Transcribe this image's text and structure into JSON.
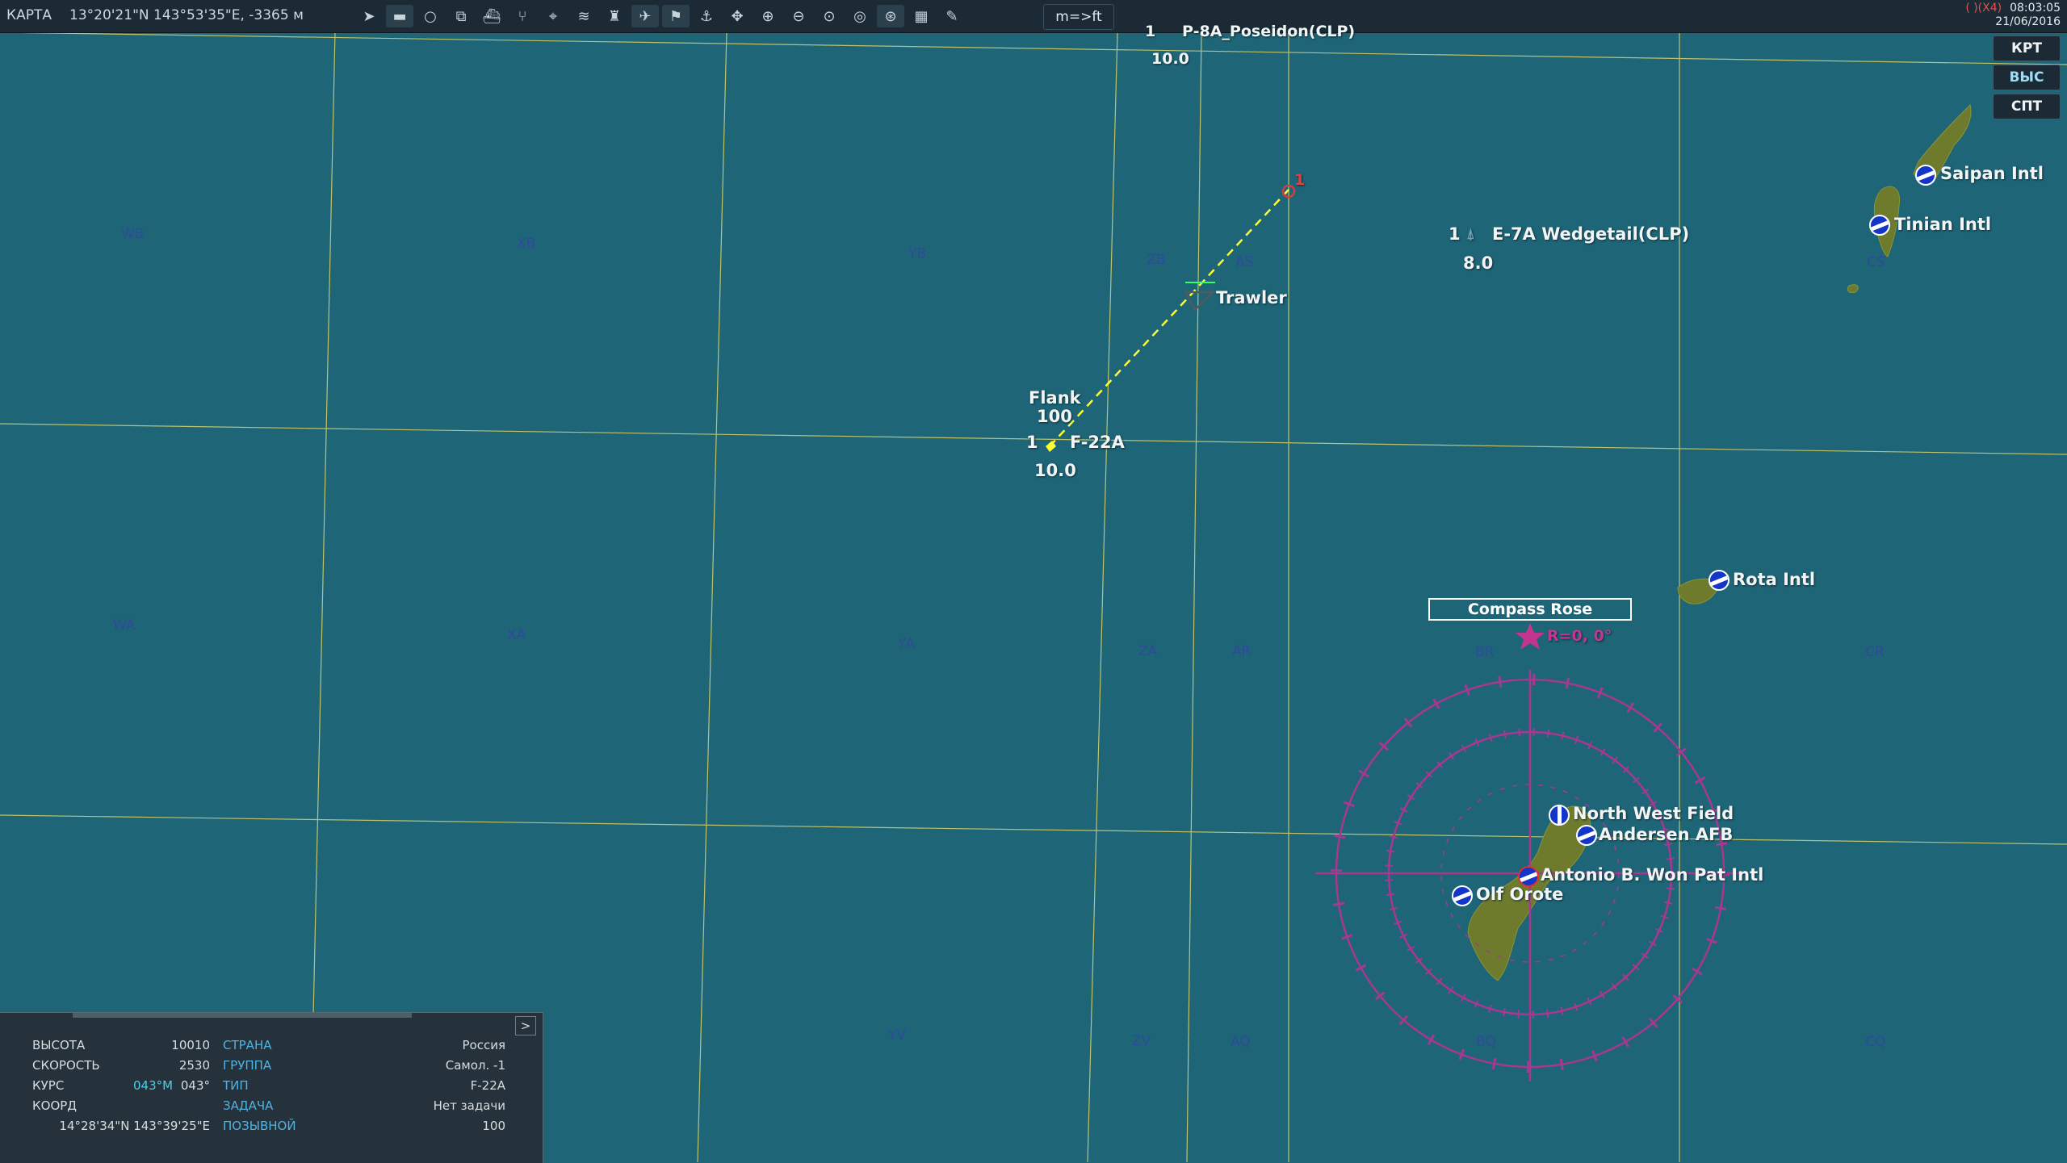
{
  "header": {
    "mode": "КАРТА",
    "cursor_coords": "13°20'21\"N 143°53'35\"E, -3365 м",
    "units_button": "m=>ft",
    "warning": "( )(X4)",
    "time": "08:03:05",
    "date": "21/06/2016"
  },
  "right_buttons": [
    "КРТ",
    "ВЫС",
    "СПТ"
  ],
  "toolbar_icons": [
    "navigate-icon",
    "ruler-icon",
    "circle-icon",
    "layers-icon",
    "ship-icon",
    "route-icon",
    "target-icon",
    "wifi-icon",
    "tower-icon",
    "aircraft-label-icon",
    "ground-label-icon",
    "naval-label-icon",
    "pan-icon",
    "zoom-in-icon",
    "zoom-out-icon",
    "zoom-fit-icon",
    "radar-icon",
    "globe-icon",
    "grid-icon",
    "pencil-icon"
  ],
  "grid_labels": [
    "WB",
    "XB",
    "YB",
    "ZB",
    "AS",
    "CS",
    "WA",
    "XA",
    "YA",
    "ZA",
    "AR",
    "BR",
    "CR",
    "YV",
    "ZV",
    "AQ",
    "BQ",
    "CQ"
  ],
  "units": {
    "top": {
      "count": "1",
      "name": "P-8A_Poseidon(CLP)",
      "altitude": "10.0"
    },
    "e7": {
      "count": "1",
      "name": "E-7A Wedgetail(CLP)",
      "altitude": "8.0"
    },
    "f22": {
      "count": "1",
      "name": "F-22A",
      "altitude": "10.0"
    },
    "flank": {
      "title": "Flank",
      "value": "100"
    },
    "trawler": "Trawler",
    "waypoint": "1"
  },
  "airfields": {
    "saipan": "Saipan Intl",
    "tinian": "Tinian Intl",
    "rota": "Rota Intl",
    "north_west": "North West Field",
    "andersen": "Andersen AFB",
    "antonio": "Antonio B. Won Pat Intl",
    "olf": "Olf Orote"
  },
  "compass": {
    "label": "Compass Rose",
    "bullseye": "R=0, 0°"
  },
  "info_panel": {
    "left": [
      {
        "key": "ВЫСОТА",
        "value": "10010"
      },
      {
        "key": "СКОРОСТЬ",
        "value": "2530"
      },
      {
        "key": "КУРС",
        "value": "043°",
        "magnetic": "043°M"
      },
      {
        "key": "КООРД",
        "value": "14°28'34\"N 143°39'25\"E"
      }
    ],
    "right": [
      {
        "key": "СТРАНА",
        "value": "Россия"
      },
      {
        "key": "ГРУППА",
        "value": "Самол. -1"
      },
      {
        "key": "ТИП",
        "value": "F-22A"
      },
      {
        "key": "ЗАДАЧА",
        "value": "Нет задачи"
      },
      {
        "key": "ПОЗЫВНОЙ",
        "value": "100"
      }
    ],
    "expand": ">"
  },
  "colors": {
    "sea": "#1e6577",
    "grid": "#d9d36a",
    "route": "#ffff33",
    "compass": "#a8388f",
    "land": "#6f7a2a",
    "airfield": "#1336c8"
  }
}
